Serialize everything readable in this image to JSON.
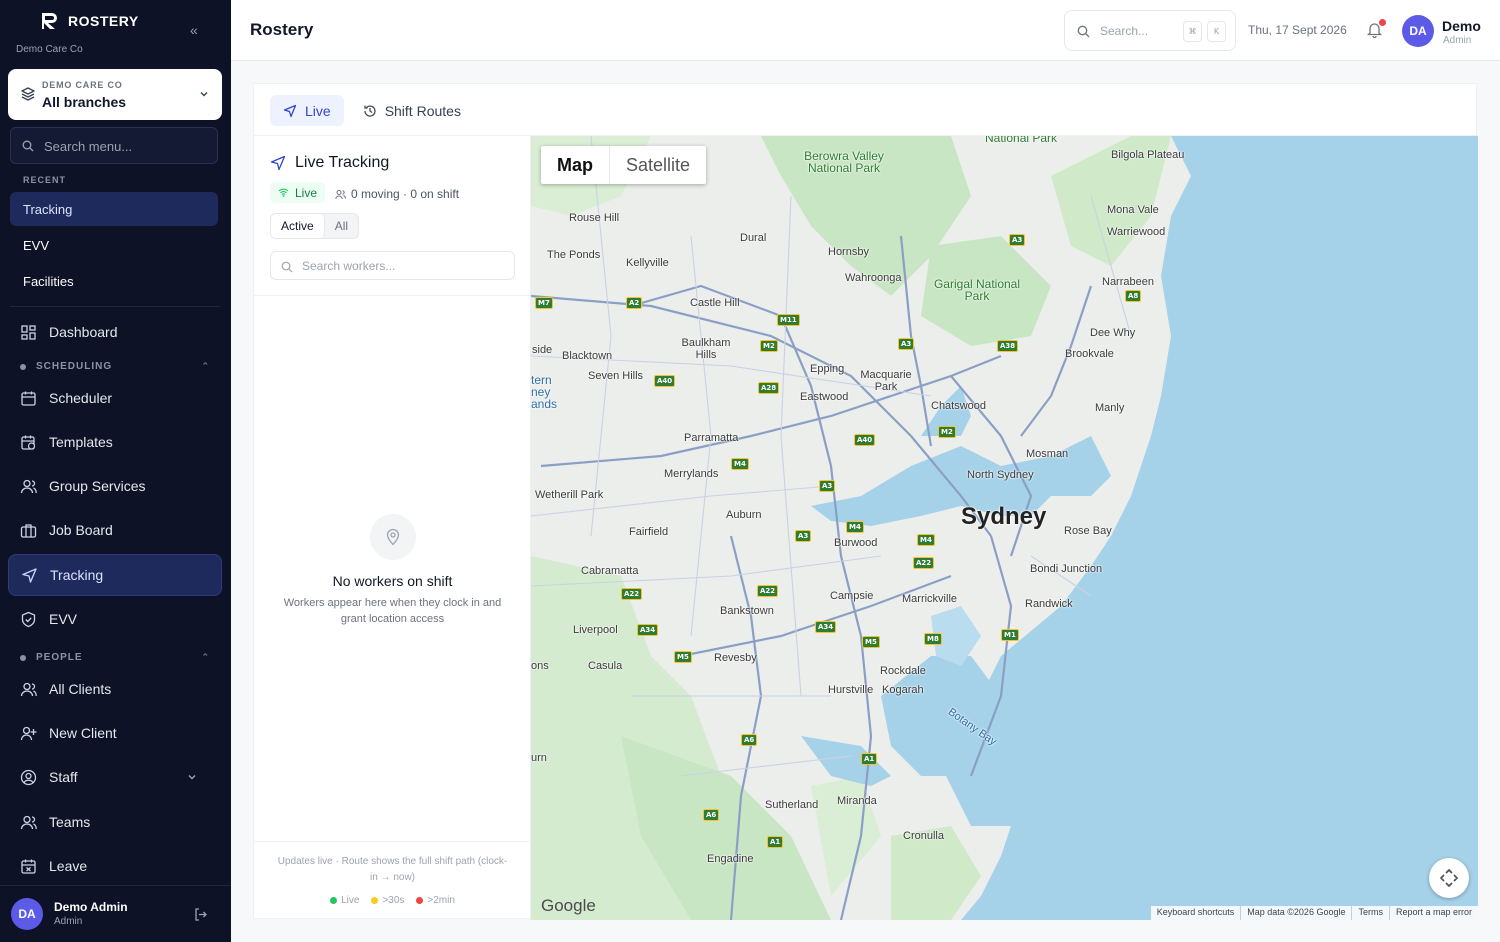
{
  "app": {
    "name": "ROSTERY",
    "org_sub": "Demo Care Co",
    "branch_org": "DEMO CARE CO",
    "branch_name": "All branches",
    "search_menu_placeholder": "Search menu...",
    "recent_label": "RECENT",
    "recent": [
      "Tracking",
      "EVV",
      "Facilities"
    ],
    "nav": {
      "dashboard": "Dashboard",
      "scheduling_label": "SCHEDULING",
      "scheduler": "Scheduler",
      "templates": "Templates",
      "group_services": "Group Services",
      "job_board": "Job Board",
      "tracking": "Tracking",
      "evv": "EVV",
      "people_label": "PEOPLE",
      "all_clients": "All Clients",
      "new_client": "New Client",
      "staff": "Staff",
      "teams": "Teams",
      "leave": "Leave"
    },
    "user": {
      "initials": "DA",
      "name": "Demo Admin",
      "role": "Admin"
    }
  },
  "header": {
    "title": "Rostery",
    "search_placeholder": "Search...",
    "kbd_cmd": "⌘",
    "kbd_k": "K",
    "date": "Thu, 17 Sept 2026",
    "user_initials": "DA",
    "user_name": "Demo",
    "user_role": "Admin"
  },
  "tabs": {
    "live": "Live",
    "shift_routes": "Shift Routes"
  },
  "panel": {
    "title": "Live Tracking",
    "live_badge": "Live",
    "counts": "0 moving · 0 on shift",
    "filter_active": "Active",
    "filter_all": "All",
    "search_placeholder": "Search workers...",
    "empty_title": "No workers on shift",
    "empty_sub": "Workers appear here when they clock in and grant location access",
    "footer": "Updates live · Route shows the full shift path (clock-in → now)",
    "legend": [
      {
        "label": "Live",
        "color": "#22c55e"
      },
      {
        "label": ">30s",
        "color": "#facc15"
      },
      {
        "label": ">2min",
        "color": "#ef4444"
      }
    ]
  },
  "map": {
    "type_map": "Map",
    "type_satellite": "Satellite",
    "city": "Sydney",
    "labels": {
      "national_park_top": "National Park",
      "berowra": "Berowra Valley National Park",
      "bilgola": "Bilgola Plateau",
      "mona_vale": "Mona Vale",
      "warriewood": "Warriewood",
      "rouse_hill": "Rouse Hill",
      "dural": "Dural",
      "hornsby": "Hornsby",
      "the_ponds": "The Ponds",
      "kellyville": "Kellyville",
      "wahroonga": "Wahroonga",
      "garigal": "Garigal National Park",
      "narrabeen": "Narrabeen",
      "castle_hill": "Castle Hill",
      "dee_why": "Dee Why",
      "baulkham": "Baulkham Hills",
      "brookvale": "Brookvale",
      "side": "side",
      "blacktown": "Blacktown",
      "epping": "Epping",
      "macquarie": "Macquarie Park",
      "seven_hills": "Seven Hills",
      "western_sydney": "tern ney ands",
      "eastwood": "Eastwood",
      "chatswood": "Chatswood",
      "manly": "Manly",
      "parramatta": "Parramatta",
      "mosman": "Mosman",
      "merrylands": "Merrylands",
      "north_sydney": "North Sydney",
      "wetherill": "Wetherill Park",
      "auburn": "Auburn",
      "rose_bay": "Rose Bay",
      "fairfield": "Fairfield",
      "burwood": "Burwood",
      "cabramatta": "Cabramatta",
      "bondi": "Bondi Junction",
      "campsie": "Campsie",
      "marrickville": "Marrickville",
      "randwick": "Randwick",
      "bankstown": "Bankstown",
      "liverpool": "Liverpool",
      "revesby": "Revesby",
      "casula": "Casula",
      "ons": "ons",
      "rockdale": "Rockdale",
      "hurstville": "Hurstville",
      "kogarah": "Kogarah",
      "botany_bay": "Botany Bay",
      "urn": "urn",
      "sutherland": "Sutherland",
      "miranda": "Miranda",
      "cronulla": "Cronulla",
      "engadine": "Engadine"
    },
    "logo": "Google",
    "attribution": [
      "Keyboard shortcuts",
      "Map data ©2026 Google",
      "Terms",
      "Report a map error"
    ]
  }
}
